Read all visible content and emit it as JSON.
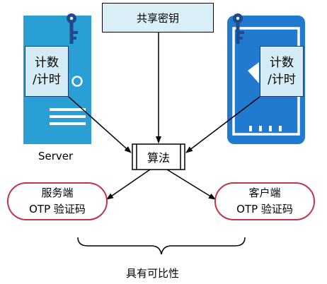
{
  "shared_key": "共享密钥",
  "server": {
    "label": "Server",
    "counter_line1": "计数",
    "counter_line2": "/计时",
    "otp_line1": "服务端",
    "otp_line2": "OTP 验证码"
  },
  "client": {
    "counter_line1": "计数",
    "counter_line2": "/计时",
    "otp_line1": "客户端",
    "otp_line2": "OTP 验证码"
  },
  "algorithm": "算法",
  "conclusion": "具有可比性",
  "colors": {
    "device_blue": "#2a9fd6",
    "phone_blue": "#1f7ad0",
    "key_navy": "#1f4a8c",
    "otp_border": "#c0354a",
    "shared_box_fill": "#d9eef6"
  }
}
